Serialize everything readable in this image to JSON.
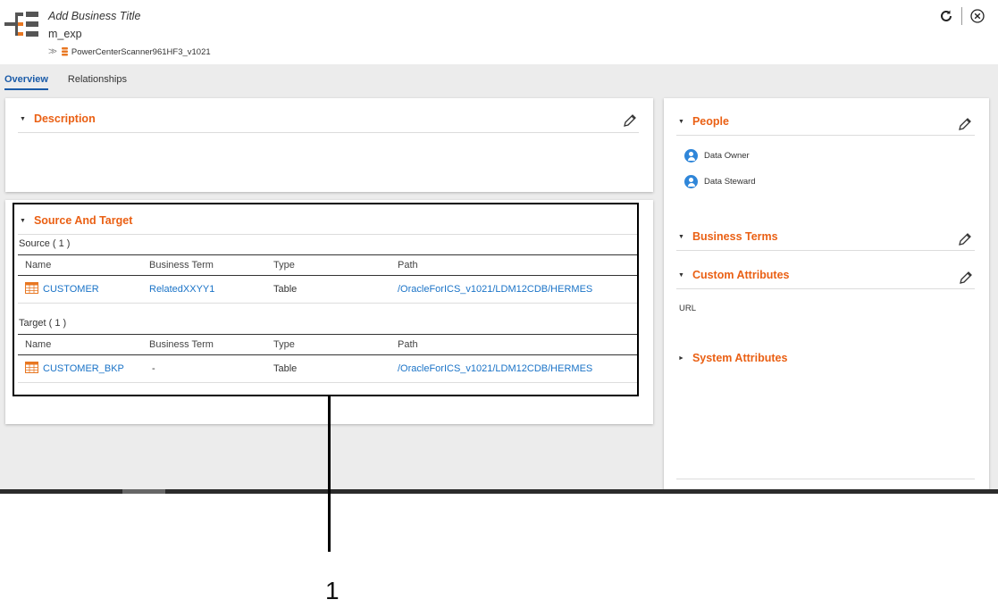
{
  "header": {
    "title": "Add Business Title",
    "name": "m_exp",
    "breadcrumb": "PowerCenterScanner961HF3_v1021"
  },
  "tabs": [
    {
      "label": "Overview",
      "active": true
    },
    {
      "label": "Relationships",
      "active": false
    }
  ],
  "description": {
    "heading": "Description"
  },
  "source_target": {
    "heading": "Source And Target",
    "columns": [
      "Name",
      "Business Term",
      "Type",
      "Path"
    ],
    "source": {
      "label": "Source ( 1 )",
      "rows": [
        {
          "name": "CUSTOMER",
          "business_term": "RelatedXXYY1",
          "type": "Table",
          "path": "/OracleForICS_v1021/LDM12CDB/HERMES"
        }
      ]
    },
    "target": {
      "label": "Target ( 1 )",
      "rows": [
        {
          "name": "CUSTOMER_BKP",
          "business_term": "-",
          "type": "Table",
          "path": "/OracleForICS_v1021/LDM12CDB/HERMES"
        }
      ]
    }
  },
  "people": {
    "heading": "People",
    "items": [
      "Data Owner",
      "Data Steward"
    ]
  },
  "business_terms": {
    "heading": "Business Terms"
  },
  "custom_attributes": {
    "heading": "Custom Attributes",
    "fields": [
      "URL"
    ]
  },
  "system_attributes": {
    "heading": "System Attributes"
  },
  "callout": {
    "number": "1"
  },
  "colors": {
    "accent": "#ea6014",
    "link": "#1a73c7",
    "tab_active": "#1a5ba8",
    "avatar": "#2f86d9"
  }
}
